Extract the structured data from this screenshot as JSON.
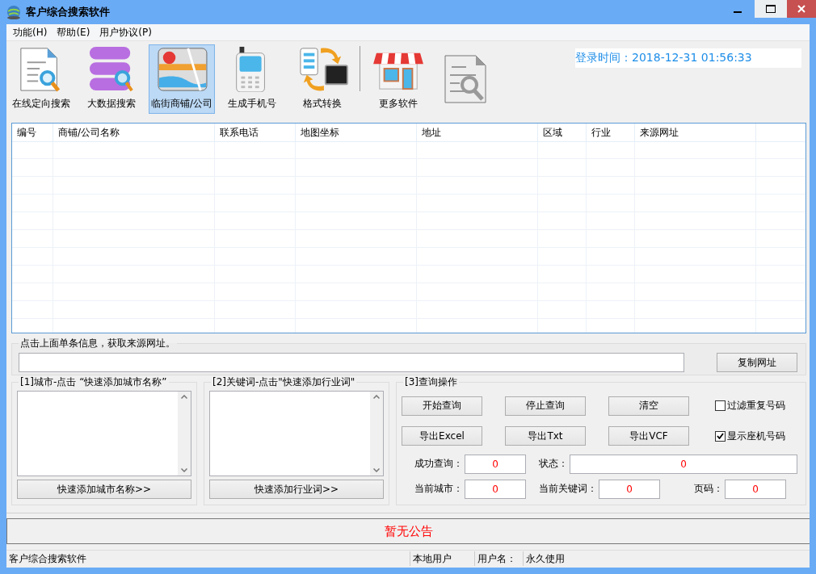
{
  "window": {
    "title": "客户综合搜索软件"
  },
  "menu": [
    "功能(H)",
    "帮助(E)",
    "用户协议(P)"
  ],
  "toolbar": {
    "items": [
      {
        "label": "在线定向搜索",
        "kind": "doc-search",
        "selected": false
      },
      {
        "label": "大数据搜索",
        "kind": "database",
        "selected": false
      },
      {
        "label": "临街商铺/公司",
        "kind": "map",
        "selected": true
      },
      {
        "label": "生成手机号",
        "kind": "phone",
        "selected": false
      },
      {
        "label": "格式转换",
        "kind": "convert",
        "selected": false
      },
      {
        "label": "更多软件",
        "kind": "shop",
        "selected": false
      }
    ],
    "login_time": "登录时间：2018-12-31 01:56:33"
  },
  "table": {
    "columns": [
      "编号",
      "商铺/公司名称",
      "联系电话",
      "地图坐标",
      "地址",
      "区域",
      "行业",
      "来源网址"
    ]
  },
  "url_group": {
    "legend": "点击上面单条信息，获取来源网址。",
    "button": "复制网址"
  },
  "city_panel": {
    "legend": "[1]城市-点击 “快速添加城市名称”",
    "button": "快速添加城市名称>>"
  },
  "keyword_panel": {
    "legend": "[2]关键词-点击\"快速添加行业词\"",
    "button": "快速添加行业词>>"
  },
  "query_panel": {
    "legend": "[3]查询操作",
    "button_rows": [
      {
        "buttons": [
          "开始查询",
          "停止查询",
          "清空"
        ],
        "checkbox": {
          "label": "过滤重复号码",
          "checked": false
        }
      },
      {
        "buttons": [
          "导出Excel",
          "导出Txt",
          "导出VCF"
        ],
        "checkbox": {
          "label": "显示座机号码",
          "checked": true
        }
      }
    ],
    "stat_rows": [
      [
        {
          "label": "成功查询：",
          "value": "0",
          "kind": "narrow"
        },
        {
          "label": "状态：",
          "value": "0",
          "kind": "wide"
        }
      ],
      [
        {
          "label": "当前城市：",
          "value": "0",
          "kind": "narrow"
        },
        {
          "label": "当前关键词：",
          "value": "0",
          "kind": "narrow"
        },
        {
          "label": "页码：",
          "value": "0",
          "kind": "narrow"
        }
      ]
    ]
  },
  "notice": "暂无公告",
  "status_bar": [
    "客户综合搜索软件",
    "本地用户",
    "用户名：",
    "永久使用"
  ]
}
